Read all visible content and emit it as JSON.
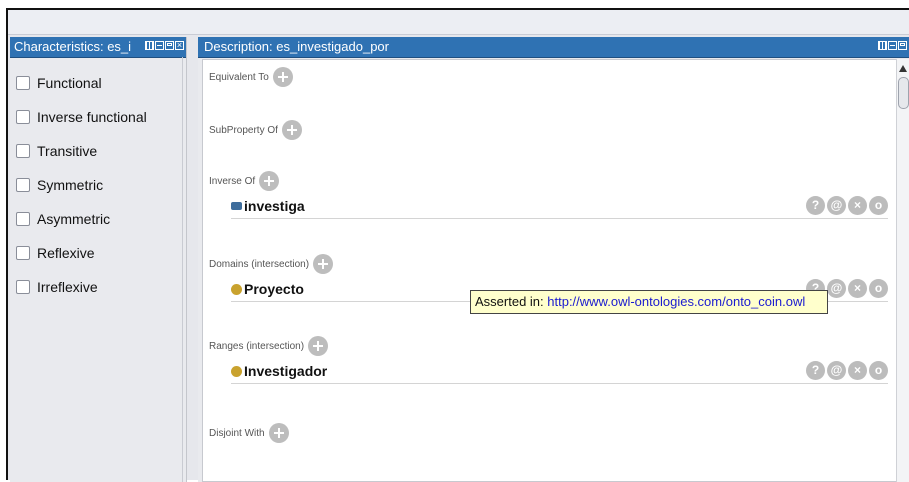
{
  "characteristics_panel": {
    "title": "Characteristics: es_i",
    "items": [
      {
        "label": "Functional",
        "checked": false
      },
      {
        "label": "Inverse functional",
        "checked": false
      },
      {
        "label": "Transitive",
        "checked": false
      },
      {
        "label": "Symmetric",
        "checked": false
      },
      {
        "label": "Asymmetric",
        "checked": false
      },
      {
        "label": "Reflexive",
        "checked": false
      },
      {
        "label": "Irreflexive",
        "checked": false
      }
    ]
  },
  "description_panel": {
    "title": "Description: es_investigado_por",
    "sections": {
      "equivalent_to": {
        "label": "Equivalent To"
      },
      "subproperty_of": {
        "label": "SubProperty Of"
      },
      "inverse_of": {
        "label": "Inverse Of",
        "entry": "investiga"
      },
      "domains": {
        "label": "Domains (intersection)",
        "entry": "Proyecto"
      },
      "ranges": {
        "label": "Ranges (intersection)",
        "entry": "Investigador"
      },
      "disjoint_with": {
        "label": "Disjoint With"
      }
    },
    "action_icons": {
      "help": "?",
      "annotate": "@",
      "delete": "×",
      "edit": "o"
    }
  },
  "tooltip": {
    "prefix": "Asserted in: ",
    "url": "http://www.owl-ontologies.com/onto_coin.owl"
  },
  "colors": {
    "header_bg": "#2f72b3",
    "object_property_marker": "#3e6d9c",
    "class_marker": "#c9a22e",
    "tooltip_bg": "#ffffcc"
  }
}
